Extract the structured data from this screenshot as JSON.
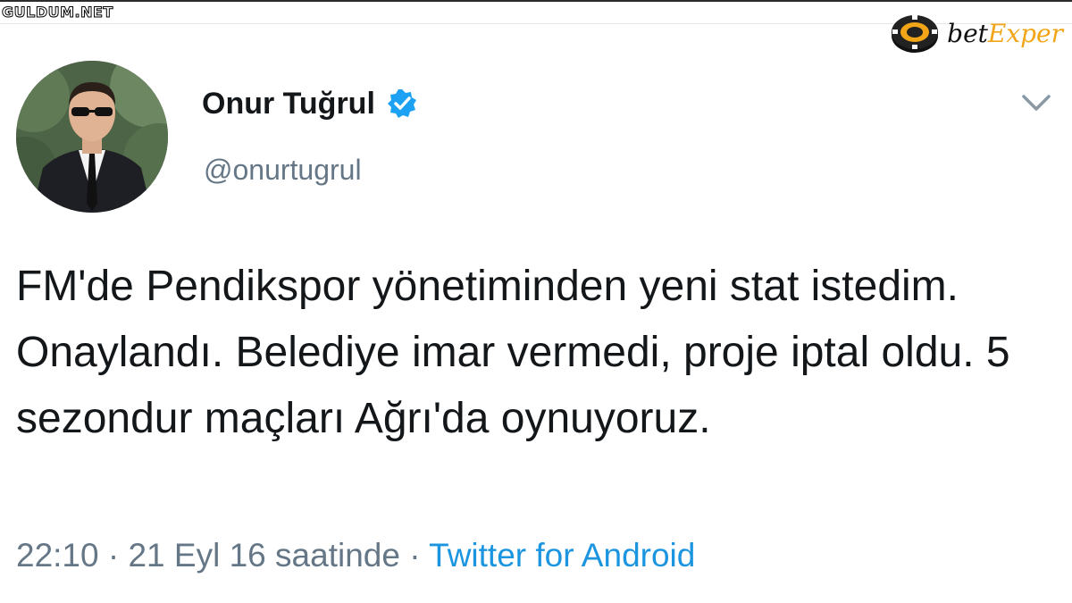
{
  "watermarks": {
    "left": "GULDUM.NET",
    "right_prefix": "bet",
    "right_accent": "Exper",
    "right_accent_color": "#f2a516",
    "right_icon": "casino-chip-icon"
  },
  "tweet": {
    "author": {
      "display_name": "Onur Tuğrul",
      "handle": "@onurtugrul",
      "verified": true,
      "verified_icon": "verified-badge-icon",
      "avatar": "profile-photo"
    },
    "menu_icon": "chevron-down-icon",
    "text": "FM'de Pendikspor yönetiminden yeni stat istedim. Onaylandı. Belediye imar vermedi, proje iptal oldu. 5 sezondur maçları Ağrı'da oynuyoruz.",
    "time": "22:10",
    "separator_1": "·",
    "date": "21 Eyl 16 saatinde",
    "separator_2": "·",
    "source": "Twitter for Android"
  },
  "colors": {
    "text": "#14171a",
    "secondary": "#657786",
    "link": "#1b95e0",
    "verified": "#1da1f2"
  }
}
